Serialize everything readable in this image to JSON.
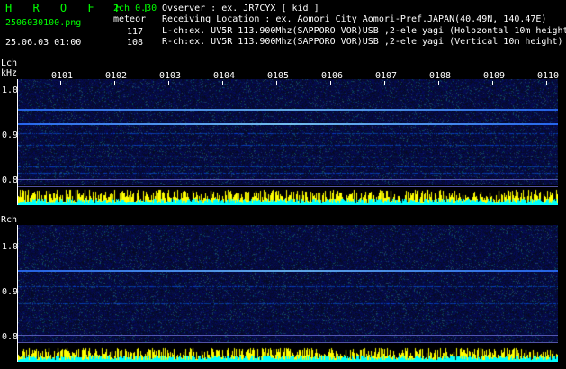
{
  "header": {
    "app_title": "H R O F F T",
    "mode": "2ch 0.30",
    "filename": "2506030100.png",
    "timestamp": "25.06.03 01:00",
    "event_label": "meteor",
    "count_l": "117",
    "count_r": "108",
    "observer": "Ovserver              : ex. JR7CYX [ kid ]",
    "location": "Receiving Location : ex. Aomori City Aomori-Pref.JAPAN(40.49N, 140.47E)",
    "lch_info": "L-ch:ex. UV5R 113.900Mhz(SAPPORO VOR)USB ,2-ele yagi (Holozontal 10m height)",
    "rch_info": "R-ch:ex. UV5R 113.900Mhz(SAPPORO VOR)USB ,2-ele yagi (Vertical 10m height)"
  },
  "channels": {
    "lch_label": "Lch",
    "unit_label": "kHz",
    "rch_label": "Rch"
  },
  "time_ticks": [
    "0101",
    "0102",
    "0103",
    "0104",
    "0105",
    "0106",
    "0107",
    "0108",
    "0109",
    "0110"
  ],
  "freq_ticks": [
    "1.0",
    "0.9",
    "0.8"
  ],
  "colors": {
    "text_green": "#00ff00",
    "text_white": "#ffffff",
    "background": "#000000",
    "spectrum_bg": "#0a0a3a",
    "carrier": "#4da3ff",
    "amp_yellow": "#ffff00",
    "amp_cyan": "#00ffff"
  }
}
